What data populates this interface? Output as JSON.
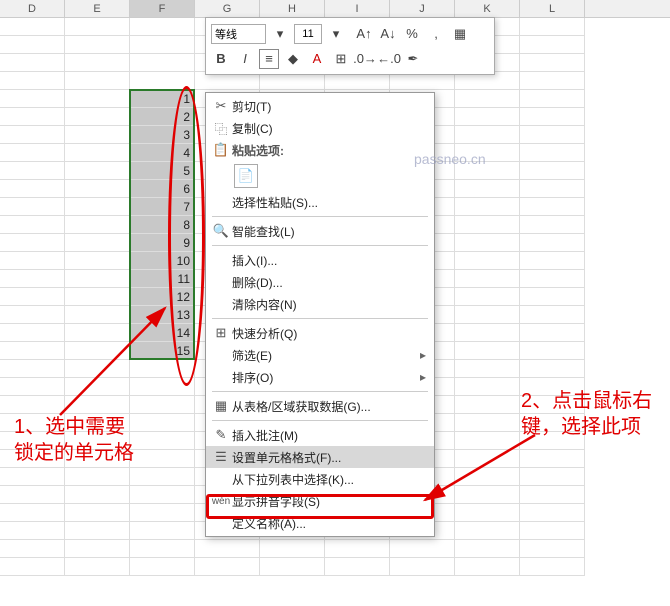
{
  "columns": [
    "D",
    "E",
    "F",
    "G",
    "H",
    "I",
    "J",
    "K",
    "L"
  ],
  "selectedCol": "F",
  "selectedColIndex": 2,
  "values": [
    1,
    2,
    3,
    4,
    5,
    6,
    7,
    8,
    9,
    10,
    11,
    12,
    13,
    14,
    15
  ],
  "rowCount": 31,
  "miniToolbar": {
    "font": "等线",
    "size": "11",
    "buttons1": [
      {
        "name": "font-grow-icon",
        "glyph": "A↑"
      },
      {
        "name": "font-shrink-icon",
        "glyph": "A↓"
      },
      {
        "name": "percent-icon",
        "glyph": "%"
      },
      {
        "name": "comma-icon",
        "glyph": ","
      },
      {
        "name": "grid-icon",
        "glyph": "▦"
      }
    ],
    "buttons2": [
      {
        "name": "bold-icon",
        "glyph": "B",
        "style": "font-weight:bold"
      },
      {
        "name": "italic-icon",
        "glyph": "I",
        "style": "font-style:italic"
      },
      {
        "name": "align-icon",
        "glyph": "≡",
        "boxed": true
      },
      {
        "name": "fill-icon",
        "glyph": "◆"
      },
      {
        "name": "font-color-icon",
        "glyph": "A",
        "cls": "acc"
      },
      {
        "name": "border-icon",
        "glyph": "⊞"
      },
      {
        "name": "decimal-inc-icon",
        "glyph": ".0→"
      },
      {
        "name": "decimal-dec-icon",
        "glyph": "←.0"
      },
      {
        "name": "format-painter-icon",
        "glyph": "✒"
      }
    ]
  },
  "ctx": {
    "cut": "剪切(T)",
    "copy": "复制(C)",
    "pasteHead": "粘贴选项:",
    "pasteSpecial": "选择性粘贴(S)...",
    "smartLookup": "智能查找(L)",
    "insert": "插入(I)...",
    "delete": "删除(D)...",
    "clear": "清除内容(N)",
    "quickAnalysis": "快速分析(Q)",
    "filter": "筛选(E)",
    "sort": "排序(O)",
    "getData": "从表格/区域获取数据(G)...",
    "insertComment": "插入批注(M)",
    "formatCells": "设置单元格格式(F)...",
    "dropdown": "从下拉列表中选择(K)...",
    "phonetic": "显示拼音字段(S)",
    "defineName": "定义名称(A)..."
  },
  "annotations": {
    "left": "1、选中需要\n锁定的单元格",
    "right": "2、点击鼠标右\n键，选择此项"
  },
  "watermark": "passneo.cn"
}
